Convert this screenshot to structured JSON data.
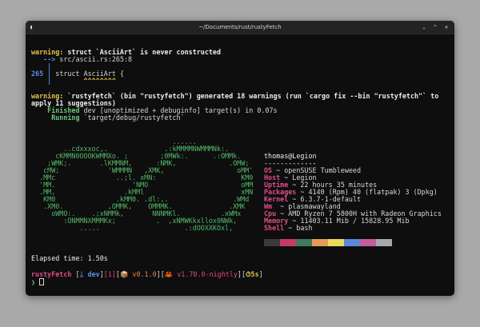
{
  "window": {
    "title": "~/Documents/rust/rustyFetch",
    "app_icon": "terminal-icon",
    "controls": [
      "minimize-icon",
      "maximize-icon",
      "close-icon"
    ]
  },
  "warning": {
    "prefix": "warning:",
    "message": " struct `AsciiArt` is never constructed",
    "arrow": "   -->",
    "location": " src/ascii.rs:265:8",
    "gutter1": "    |",
    "line_no": "265",
    "code_sep": " |",
    "code": " struct AsciiArt {",
    "gutter2": "    |",
    "carets": "        ^^^^^^^^"
  },
  "summary": {
    "prefix": "warning:",
    "text1": " `rustyfetch` (bin \"rustyfetch\") generated 18 warnings (run `cargo fix --bin \"rustyfetch\"` to",
    "text2": "apply 11 suggestions)",
    "finished_label": "    Finished",
    "finished_text": " dev [unoptimized + debuginfo] target(s) in 0.07s",
    "running_label": "     Running",
    "running_text": " `target/debug/rustyfetch`"
  },
  "logo_lines": [
    "                                   ......",
    "        ..cdxxxoc,.              .:kMMMMNWMMMNk:.",
    "      cKMMN0OOOKWMMXo. ;        ;0MWk:.      .:OMMk.",
    "    ;WMK;.       .lKMMNM,      :NMK,             .OMW;",
    "   cMW;            'WMMMN   ,XMK,                  oMM'",
    "  .MMc               ..;l. xMN:                     KM0",
    "  'MM.                   'NMO                       oMM",
    "  .MM,                 .kMMl                        xMN",
    "   KM0               .kMM0. .dl:,.                .WMd",
    "   .XM0.           ,OMMK,    OMMMK.              .XMK",
    "     oWMO:.    .;xNMMk,       NNNMKl.          .xWMx",
    "        :ONMMNXMMMKx;          .  ,xNMWKkxllox0NWk,",
    "            .....                     .:dOOXXKOxl,"
  ],
  "system": {
    "user_host": "thomas@Legion",
    "separator": "-------------",
    "rows": [
      {
        "key": "OS",
        "value": " ~ openSUSE Tumbleweed"
      },
      {
        "key": "Host",
        "value": " ~ Legion"
      },
      {
        "key": "Uptime",
        "value": " ~ 22 hours 35 minutes"
      },
      {
        "key": "Packages",
        "value": " ~ 4140 (Rpm) 40 (flatpak) 3 (Dpkg)"
      },
      {
        "key": "Kernel",
        "value": " ~ 6.3.7-1-default"
      },
      {
        "key": "Wm",
        "value": "  ~ plasmawayland"
      },
      {
        "key": "Cpu",
        "value": " ~ AMD Ryzen 7 5800H with Radeon Graphics"
      },
      {
        "key": "Memory",
        "value": " ~ 11403.11 Mib / 15828.95 Mib"
      },
      {
        "key": "Shell",
        "value": " ~ bash"
      }
    ],
    "palette": [
      "#3a3a3a",
      "#c63a63",
      "#3f7a5a",
      "#e69a5a",
      "#e8dc5a",
      "#5a8ad6",
      "#c65a9e",
      "#a8a8a8"
    ]
  },
  "elapsed": "Elapsed time: 1.50s",
  "prompt": {
    "dir": "rustyFetch",
    "git_open": " [",
    "git_icon": "ᛦ",
    "git_branch": " dev",
    "git_close": "]",
    "status": "[1]",
    "pkg_open": "[",
    "pkg_icon": "📦",
    "pkg_version": " v0.1.0",
    "pkg_close": "]",
    "rust_open": "[",
    "rust_icon": "🦀",
    "rust_version": " v1.70.0-nightly",
    "rust_close": "]",
    "time_open": "[",
    "time_icon": "⏱",
    "time_value": "5s",
    "time_close": "]",
    "symbol": "❯"
  }
}
